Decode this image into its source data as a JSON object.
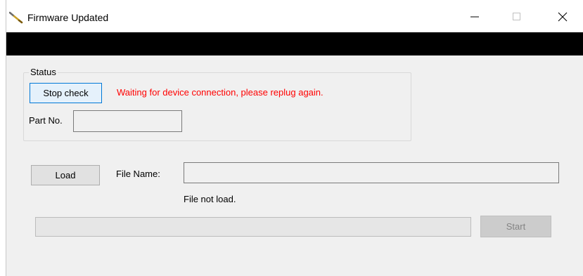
{
  "window": {
    "title": "Firmware Updated",
    "controls": [
      "minimize",
      "maximize",
      "close"
    ]
  },
  "status_group": {
    "legend": "Status",
    "stop_button_label": "Stop check",
    "status_message": "Waiting for device connection, please replug again.",
    "status_color": "#ff0000",
    "part_no_label": "Part No.",
    "part_no_value": ""
  },
  "file_section": {
    "load_button_label": "Load",
    "file_name_label": "File Name:",
    "file_name_value": "",
    "file_status": "File not load."
  },
  "progress": {
    "value": 0
  },
  "start_button": {
    "label": "Start",
    "enabled": false
  }
}
